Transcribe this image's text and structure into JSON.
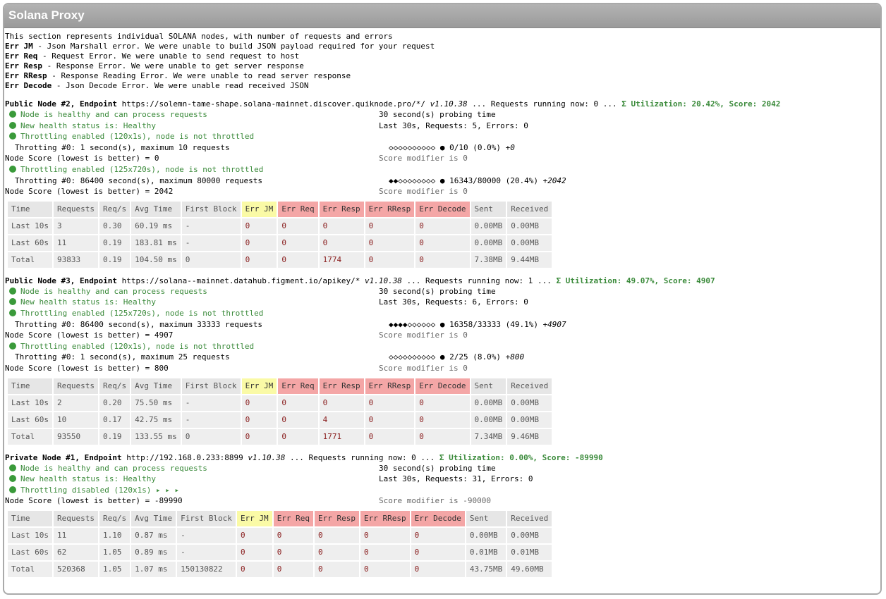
{
  "title": "Solana Proxy",
  "intro": {
    "line0": "This section represents individual SOLANA nodes, with number of requests and errors",
    "legend": [
      {
        "code": "Err JM",
        "text": " - Json Marshall error. We were unable to build JSON payload required for your request"
      },
      {
        "code": "Err Req",
        "text": " - Request Error. We were unable to send request to host"
      },
      {
        "code": "Err Resp",
        "text": " - Response Error. We were unable to get server response"
      },
      {
        "code": "Err RResp",
        "text": " - Response Reading Error. We were unable to read server response"
      },
      {
        "code": "Err Decode",
        "text": " - Json Decode Error. We were unable read received JSON"
      }
    ]
  },
  "columns": [
    "Time",
    "Requests",
    "Req/s",
    "Avg Time",
    "First Block",
    "Err JM",
    "Err Req",
    "Err Resp",
    "Err RResp",
    "Err Decode",
    "Sent",
    "Received"
  ],
  "nodes": [
    {
      "name": "Public Node #2, Endpoint",
      "endpoint": " https://solemn-tame-shape.solana-mainnet.discover.quiknode.pro/*/ ",
      "version": "v1.10.38",
      "running": " ... Requests running now: 0 ... ",
      "util": "Σ Utilization: 20.42%, Score: 2042",
      "healthy": "Node is healthy and can process requests",
      "probe": "30 second(s) probing time",
      "health": "New health status is: Healthy",
      "last30": "Last 30s, Requests: 5, Errors: 0",
      "throttles": [
        {
          "title": "Throttling enabled (120x1s), node is not throttled",
          "limit": "Throtting #0: 1 second(s), maximum 10 requests",
          "bar": "◇◇◇◇◇◇◇◇◇◇",
          "usage": " 0/10 (0.0%) ",
          "bonus": "+0",
          "score": "Node Score (lowest is better) = 0",
          "modifier": "Score modifier is 0"
        },
        {
          "title": "Throttling enabled (125x720s), node is not throttled",
          "limit": "Throtting #0: 86400 second(s), maximum 80000 requests",
          "bar": "◆◆◇◇◇◇◇◇◇◇",
          "usage": " 16343/80000 (20.4%) ",
          "bonus": "+2042",
          "score": "Node Score (lowest is better) = 2042",
          "modifier": "Score modifier is 0"
        }
      ],
      "rows": [
        [
          "Last 10s",
          "3",
          "0.30",
          "60.19 ms",
          "-",
          "0",
          "0",
          "0",
          "0",
          "0",
          "0.00MB",
          "0.00MB"
        ],
        [
          "Last 60s",
          "11",
          "0.19",
          "183.81 ms",
          "-",
          "0",
          "0",
          "0",
          "0",
          "0",
          "0.00MB",
          "0.00MB"
        ],
        [
          "Total",
          "93833",
          "0.19",
          "104.50 ms",
          "0",
          "0",
          "0",
          "1774",
          "0",
          "0",
          "7.38MB",
          "9.44MB"
        ]
      ]
    },
    {
      "name": "Public Node #3, Endpoint",
      "endpoint": " https://solana--mainnet.datahub.figment.io/apikey/* ",
      "version": "v1.10.38",
      "running": " ... Requests running now: 1 ... ",
      "util": "Σ Utilization: 49.07%, Score: 4907",
      "healthy": "Node is healthy and can process requests",
      "probe": "30 second(s) probing time",
      "health": "New health status is: Healthy",
      "last30": "Last 30s, Requests: 6, Errors: 0",
      "throttles": [
        {
          "title": "Throttling enabled (125x720s), node is not throttled",
          "limit": "Throtting #0: 86400 second(s), maximum 33333 requests",
          "bar": "◆◆◆◆◇◇◇◇◇◇",
          "usage": " 16358/33333 (49.1%) ",
          "bonus": "+4907",
          "score": "Node Score (lowest is better) = 4907",
          "modifier": "Score modifier is 0"
        },
        {
          "title": "Throttling enabled (120x1s), node is not throttled",
          "limit": "Throtting #0: 1 second(s), maximum 25 requests",
          "bar": "◇◇◇◇◇◇◇◇◇◇",
          "usage": " 2/25 (8.0%) ",
          "bonus": "+800",
          "score": "Node Score (lowest is better) = 800",
          "modifier": "Score modifier is 0"
        }
      ],
      "rows": [
        [
          "Last 10s",
          "2",
          "0.20",
          "75.50 ms",
          "-",
          "0",
          "0",
          "0",
          "0",
          "0",
          "0.00MB",
          "0.00MB"
        ],
        [
          "Last 60s",
          "10",
          "0.17",
          "42.75 ms",
          "-",
          "0",
          "0",
          "4",
          "0",
          "0",
          "0.00MB",
          "0.00MB"
        ],
        [
          "Total",
          "93550",
          "0.19",
          "133.55 ms",
          "0",
          "0",
          "0",
          "1771",
          "0",
          "0",
          "7.34MB",
          "9.46MB"
        ]
      ]
    },
    {
      "name": "Private Node #1, Endpoint",
      "endpoint": " http://192.168.0.233:8899 ",
      "version": "v1.10.38",
      "running": " ... Requests running now: 0 ... ",
      "util": "Σ Utilization: 0.00%, Score: -89990",
      "healthy": "Node is healthy and can process requests",
      "probe": "30 second(s) probing time",
      "health": "New health status is: Healthy",
      "last30": "Last 30s, Requests: 31, Errors: 0",
      "disabled": "Throttling disabled (120x1s)",
      "arrows": " ▸ ▸ ▸",
      "score": "Node Score (lowest is better) = -89990",
      "modifier": "Score modifier is -90000",
      "rows": [
        [
          "Last 10s",
          "11",
          "1.10",
          "0.87 ms",
          "-",
          "0",
          "0",
          "0",
          "0",
          "0",
          "0.00MB",
          "0.00MB"
        ],
        [
          "Last 60s",
          "62",
          "1.05",
          "0.89 ms",
          "-",
          "0",
          "0",
          "0",
          "0",
          "0",
          "0.01MB",
          "0.01MB"
        ],
        [
          "Total",
          "520368",
          "1.05",
          "1.07 ms",
          "150130822",
          "0",
          "0",
          "0",
          "0",
          "0",
          "43.75MB",
          "49.60MB"
        ]
      ]
    }
  ]
}
